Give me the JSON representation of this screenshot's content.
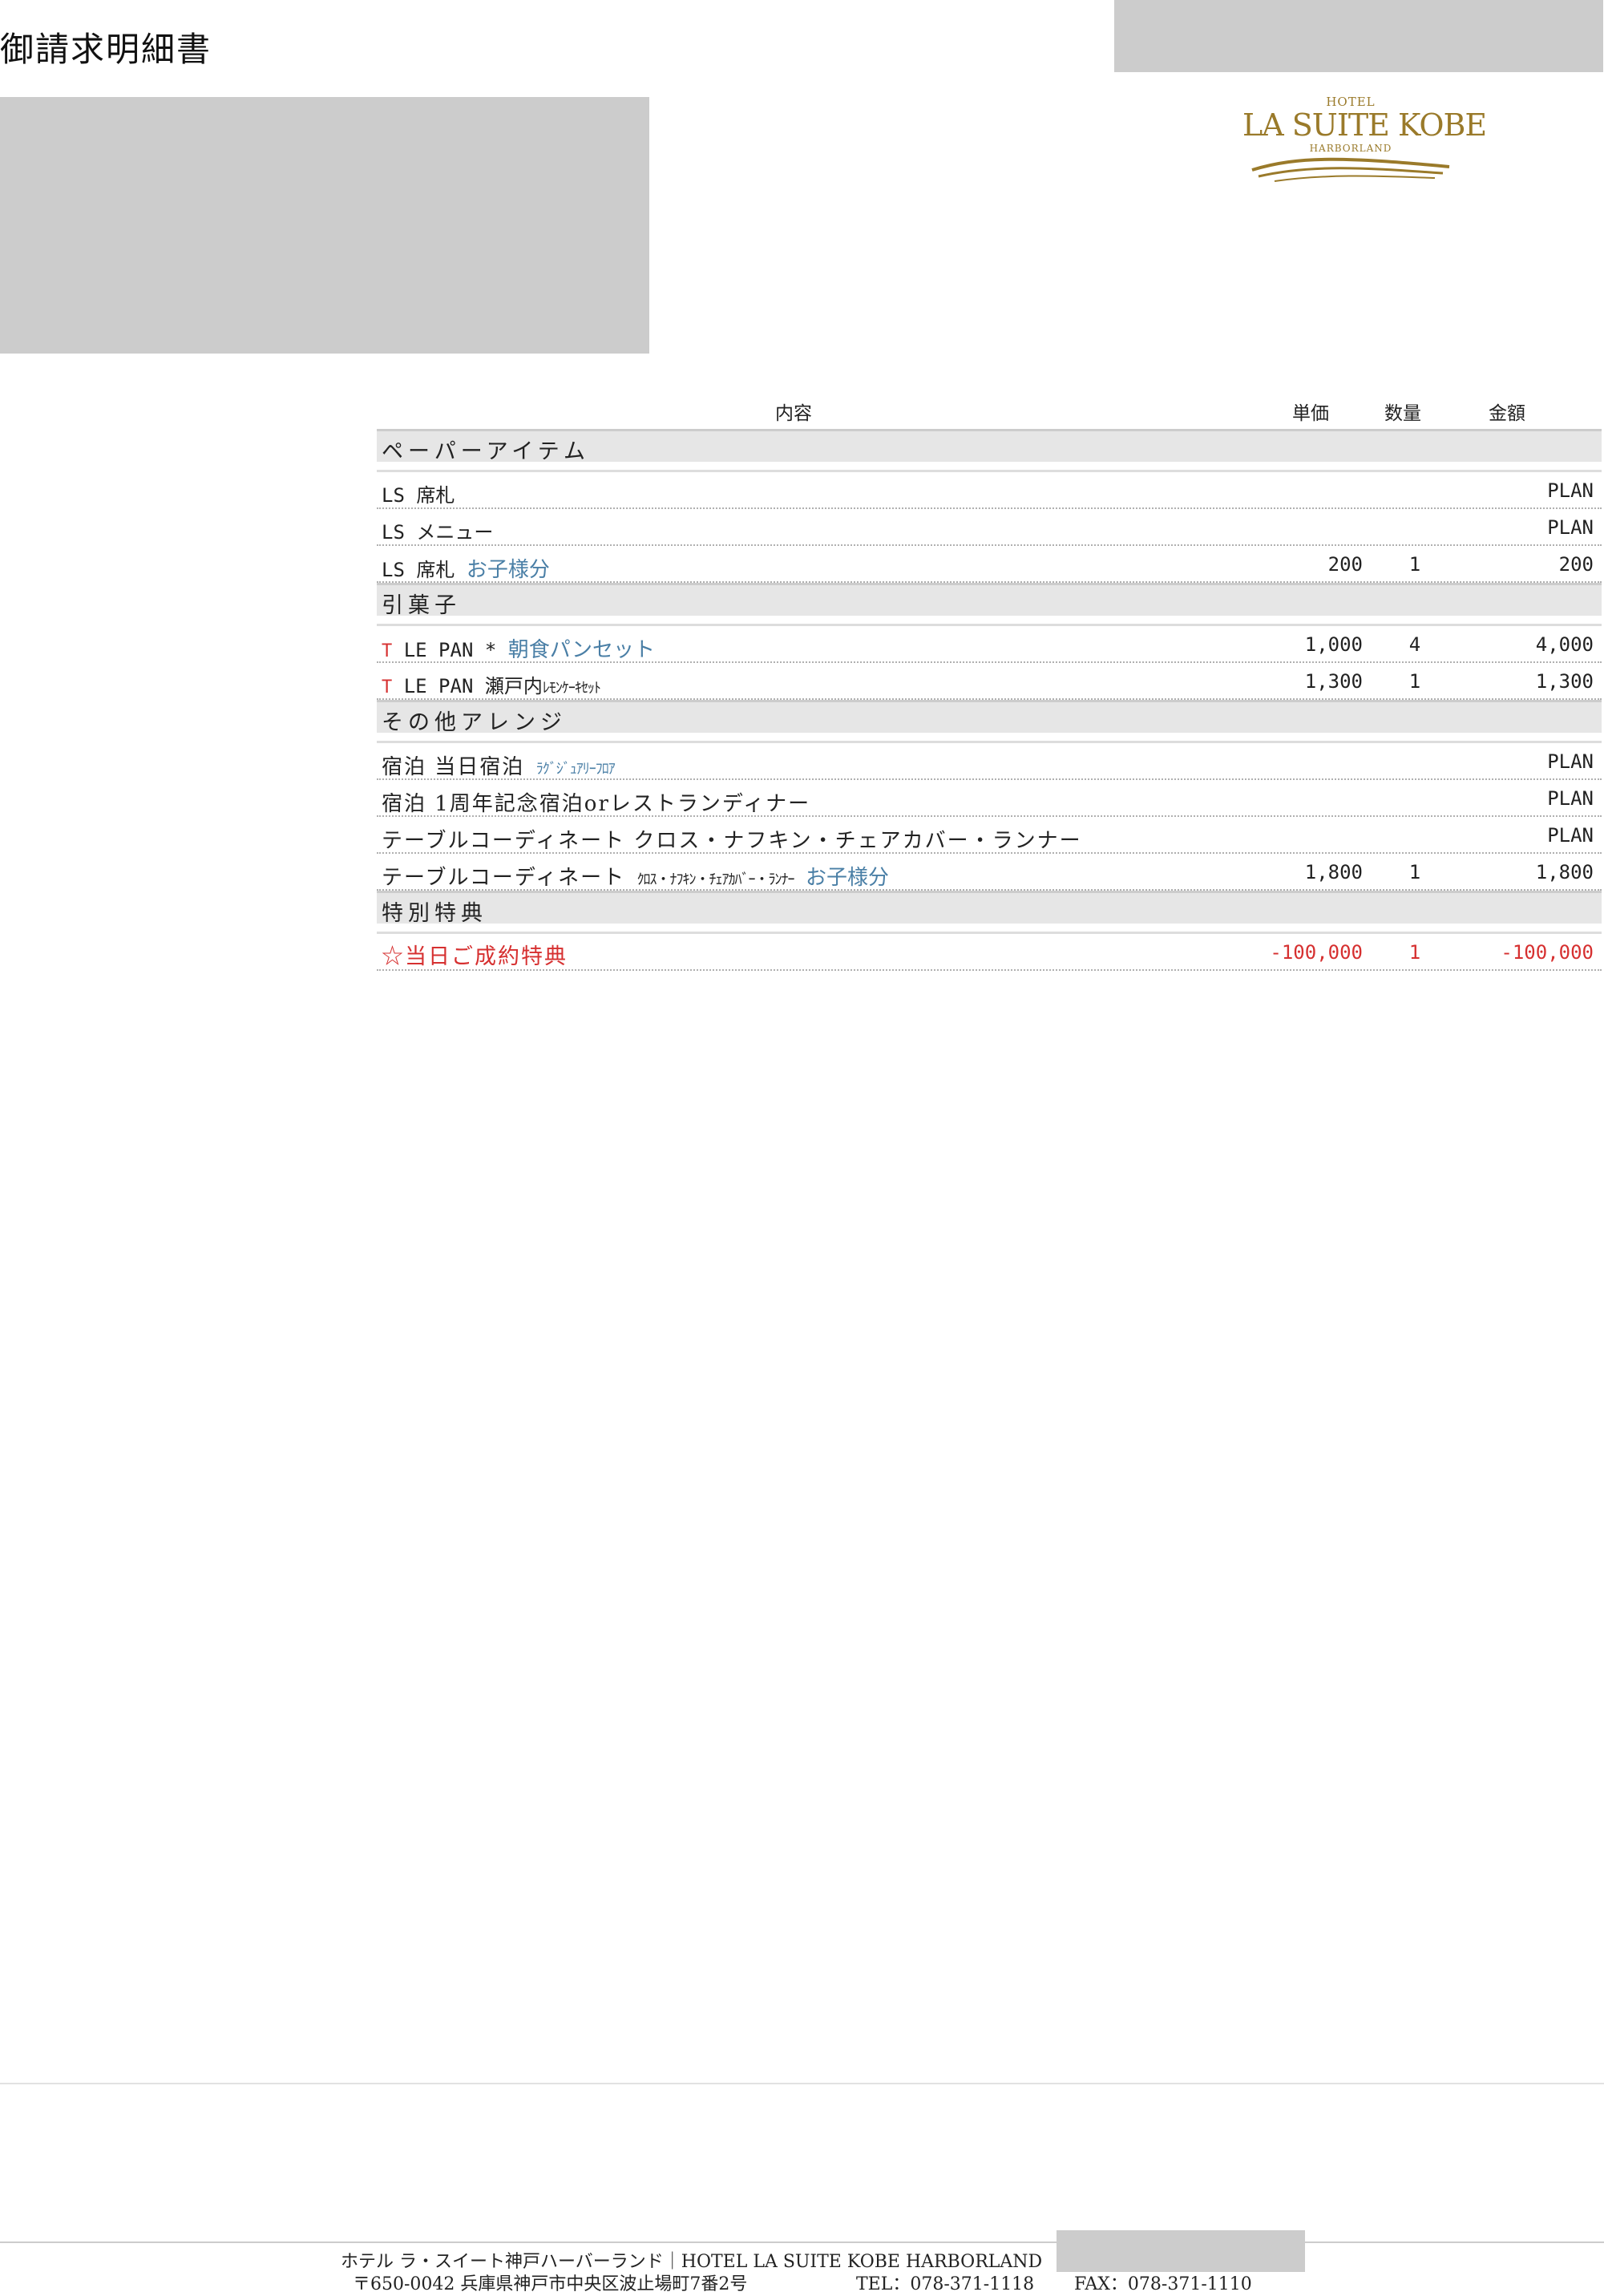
{
  "document": {
    "title": "御請求明細書"
  },
  "logo": {
    "hotel": "HOTEL",
    "name": "LA SUITE KOBE",
    "sub": "HARBORLAND"
  },
  "table": {
    "headers": {
      "content": "内容",
      "unit_price": "単価",
      "quantity": "数量",
      "amount": "金額"
    },
    "sections": [
      {
        "name": "ペーパーアイテム",
        "rows": [
          {
            "prefix": "",
            "text": "LS 席札",
            "note": "",
            "unit": "",
            "qty": "",
            "amount": "PLAN"
          },
          {
            "prefix": "",
            "text": "LS メニュー",
            "note": "",
            "unit": "",
            "qty": "",
            "amount": "PLAN"
          },
          {
            "prefix": "",
            "text": "LS 席札",
            "note": "お子様分",
            "unit": "200",
            "qty": "1",
            "amount": "200"
          }
        ]
      },
      {
        "name": "引菓子",
        "rows": [
          {
            "prefix": "T",
            "text": "LE PAN *",
            "note": "朝食パンセット",
            "unit": "1,000",
            "qty": "4",
            "amount": "4,000"
          },
          {
            "prefix": "T",
            "text": "LE PAN 瀬戸内",
            "note": "ﾚﾓﾝｹｰｷｾｯﾄ",
            "unit": "1,300",
            "qty": "1",
            "amount": "1,300"
          }
        ]
      },
      {
        "name": "その他アレンジ",
        "rows": [
          {
            "prefix": "",
            "text": "宿泊 当日宿泊",
            "note": "ﾗｸﾞｼﾞｭｱﾘｰﾌﾛｱ",
            "unit": "",
            "qty": "",
            "amount": "PLAN"
          },
          {
            "prefix": "",
            "text": "宿泊 1周年記念宿泊orレストランディナー",
            "note": "",
            "unit": "",
            "qty": "",
            "amount": "PLAN"
          },
          {
            "prefix": "",
            "text": "テーブルコーディネート クロス・ナフキン・チェアカバー・ランナー",
            "note": "",
            "unit": "",
            "qty": "",
            "amount": "PLAN"
          },
          {
            "prefix": "",
            "text": "テーブルコーディネート",
            "note": "ｸﾛｽ・ﾅﾌｷﾝ・ﾁｪｱｶﾊﾞｰ・ﾗﾝﾅｰ",
            "note2": "お子様分",
            "unit": "1,800",
            "qty": "1",
            "amount": "1,800"
          }
        ]
      },
      {
        "name": "特別特典",
        "rows": [
          {
            "prefix": "",
            "text": "☆当日ご成約特典",
            "note": "",
            "unit": "-100,000",
            "qty": "1",
            "amount": "-100,000"
          }
        ]
      }
    ]
  },
  "footer": {
    "name": "ホテル ラ・スイート神戸ハーバーランド｜HOTEL LA SUITE KOBE HARBORLAND",
    "address": "〒650-0042 兵庫県神戸市中央区波止場町7番2号",
    "tel": "TEL：078-371-1118",
    "fax": "FAX：078-371-1110"
  },
  "colors": {
    "accent_blue": "#4a7fa6",
    "accent_red": "#d63030",
    "logo_gold": "#9a7a2a"
  }
}
